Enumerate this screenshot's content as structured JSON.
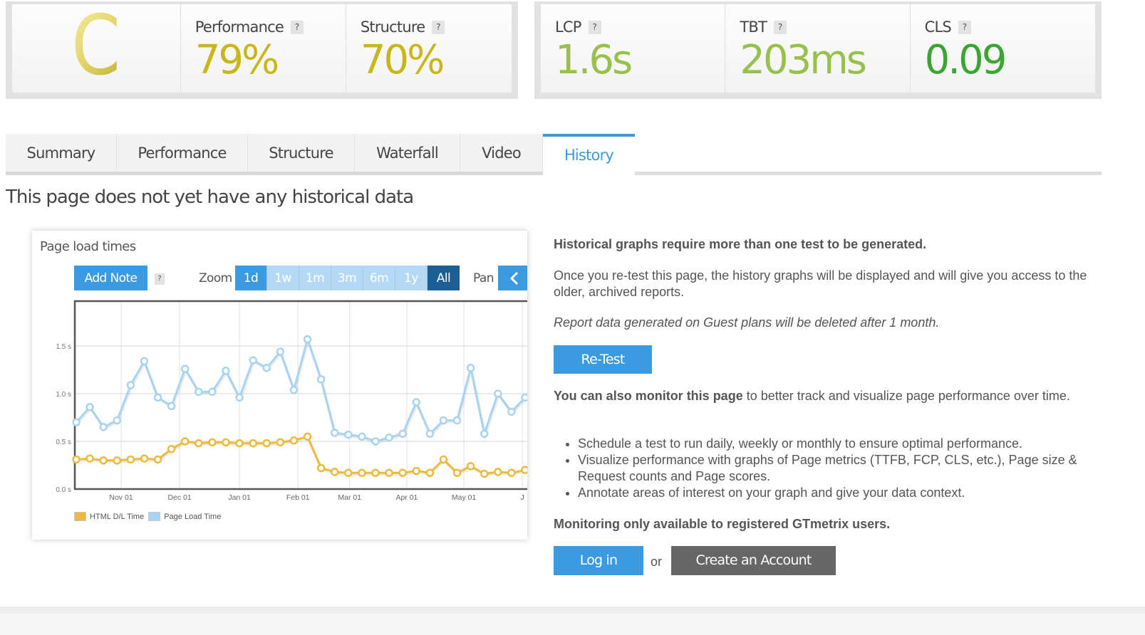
{
  "scores": {
    "grade": "C",
    "grade_color": "#d8c94e",
    "left_metrics": [
      {
        "label": "Performance",
        "value": "79%",
        "color": "#c9b718"
      },
      {
        "label": "Structure",
        "value": "70%",
        "color": "#c9b718"
      }
    ],
    "right_metrics": [
      {
        "label": "LCP",
        "value": "1.6s",
        "color": "#97c14a"
      },
      {
        "label": "TBT",
        "value": "203ms",
        "color": "#97c14a"
      },
      {
        "label": "CLS",
        "value": "0.09",
        "color": "#3ba532"
      }
    ],
    "help_glyph": "?"
  },
  "tabs": [
    {
      "label": "Summary",
      "active": false
    },
    {
      "label": "Performance",
      "active": false
    },
    {
      "label": "Structure",
      "active": false
    },
    {
      "label": "Waterfall",
      "active": false
    },
    {
      "label": "Video",
      "active": false
    },
    {
      "label": "History",
      "active": true
    }
  ],
  "page_heading": "This page does not yet have any historical data",
  "chart_panel": {
    "title": "Page load times",
    "add_note_label": "Add Note",
    "help_glyph": "?",
    "zoom_label": "Zoom",
    "zoom_options": [
      {
        "label": "1d",
        "state": "selected"
      },
      {
        "label": "1w",
        "state": "normal"
      },
      {
        "label": "1m",
        "state": "normal"
      },
      {
        "label": "3m",
        "state": "normal"
      },
      {
        "label": "6m",
        "state": "normal"
      },
      {
        "label": "1y",
        "state": "normal"
      },
      {
        "label": "All",
        "state": "active"
      }
    ],
    "pan_label": "Pan",
    "pan_icon": "chevron-left-icon"
  },
  "chart_data": {
    "type": "line",
    "title": "Page load times",
    "xlabel": "",
    "ylabel": "",
    "ylim": [
      0,
      1.9
    ],
    "y_ticks": [
      {
        "value": 0.0,
        "label": "0.0 s"
      },
      {
        "value": 0.5,
        "label": "0.5 s"
      },
      {
        "value": 1.0,
        "label": "1.0 s"
      },
      {
        "value": 1.5,
        "label": "1.5 s"
      }
    ],
    "x_ticks": [
      {
        "index": 3.3,
        "label": "Nov 01"
      },
      {
        "index": 7.6,
        "label": "Dec 01"
      },
      {
        "index": 12.0,
        "label": "Jan 01"
      },
      {
        "index": 16.3,
        "label": "Feb 01"
      },
      {
        "index": 20.1,
        "label": "Mar 01"
      },
      {
        "index": 24.3,
        "label": "Apr 01"
      },
      {
        "index": 28.5,
        "label": "May 01"
      },
      {
        "index": 32.8,
        "label": "J"
      }
    ],
    "x_count": 34,
    "grid": true,
    "legend_position": "bottom-left",
    "series": [
      {
        "name": "HTML D/L Time",
        "color": "#ecbb3d",
        "values": [
          0.31,
          0.32,
          0.3,
          0.3,
          0.31,
          0.32,
          0.31,
          0.42,
          0.5,
          0.48,
          0.49,
          0.49,
          0.48,
          0.48,
          0.48,
          0.49,
          0.51,
          0.55,
          0.22,
          0.18,
          0.17,
          0.17,
          0.17,
          0.17,
          0.17,
          0.19,
          0.17,
          0.31,
          0.17,
          0.24,
          0.16,
          0.18,
          0.17,
          0.2
        ]
      },
      {
        "name": "Page Load Time",
        "color": "#a9d3f2",
        "values": [
          0.7,
          0.86,
          0.65,
          0.72,
          1.09,
          1.34,
          0.96,
          0.87,
          1.26,
          1.02,
          1.02,
          1.24,
          0.96,
          1.35,
          1.27,
          1.44,
          1.04,
          1.57,
          1.15,
          0.59,
          0.57,
          0.55,
          0.5,
          0.54,
          0.58,
          0.91,
          0.58,
          0.72,
          0.72,
          1.27,
          0.58,
          1.0,
          0.81,
          0.96
        ]
      }
    ]
  },
  "info": {
    "heading": "Historical graphs require more than one test to be generated.",
    "paragraph": "Once you re-test this page, the history graphs will be displayed and will give you access to the older, archived reports.",
    "guest_note": "Report data generated on Guest plans will be deleted after 1 month.",
    "retest_label": "Re-Test",
    "monitor_bold": "You can also monitor this page",
    "monitor_rest": " to better track and visualize page performance over time.",
    "bullets": [
      "Schedule a test to run daily, weekly or monthly to ensure optimal performance.",
      "Visualize performance with graphs of Page metrics (TTFB, FCP, CLS, etc.), Page size & Request counts and Page scores.",
      "Annotate areas of interest on your graph and give your data context."
    ],
    "registered_note": "Monitoring only available to registered GTmetrix users.",
    "login_label": "Log in",
    "or_label": "or",
    "create_account_label": "Create an Account"
  }
}
